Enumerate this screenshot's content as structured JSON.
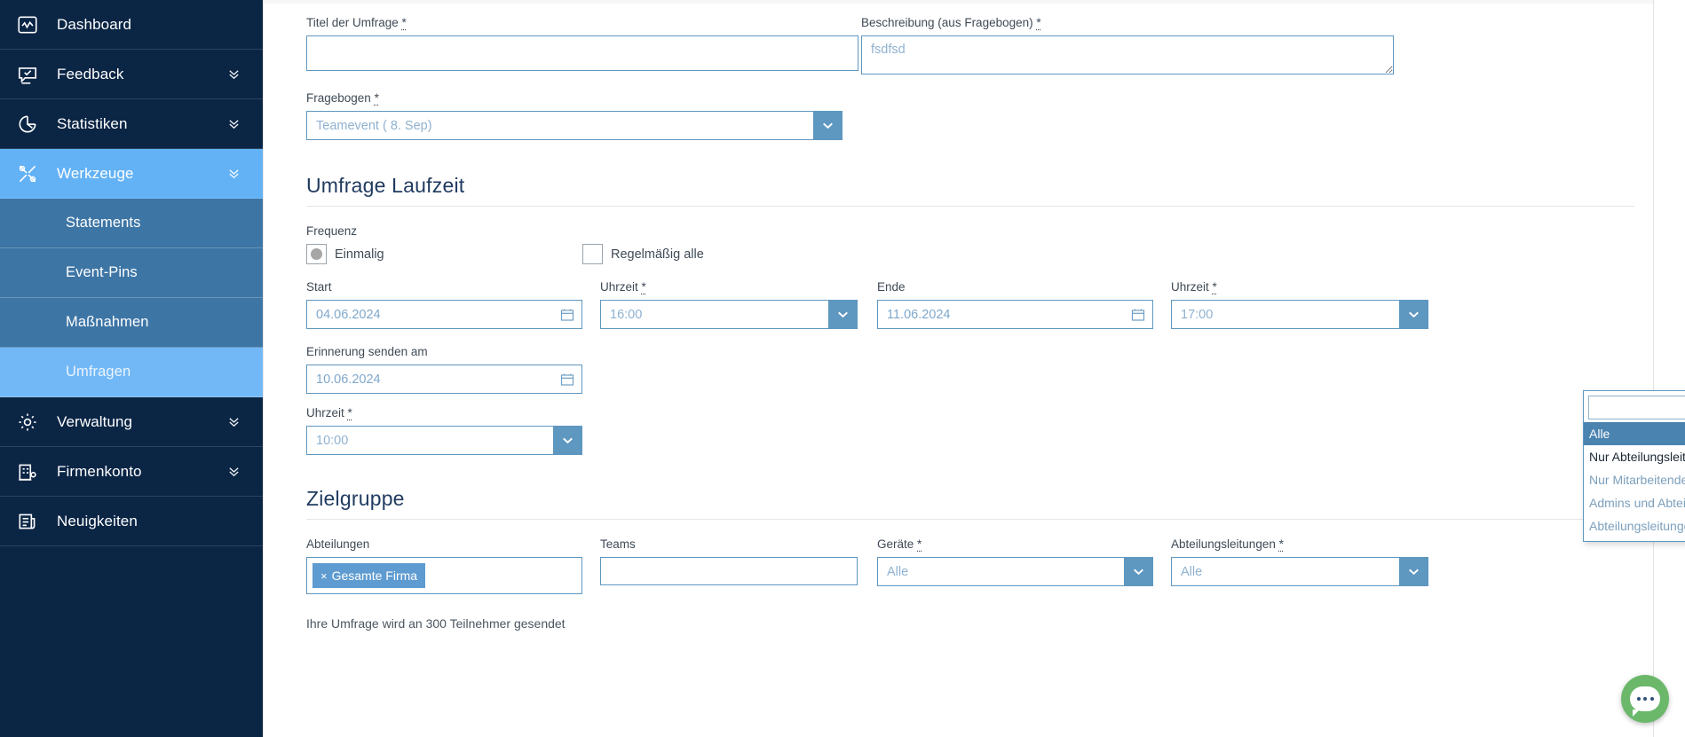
{
  "sidebar": {
    "items": [
      {
        "label": "Dashboard",
        "icon": "activity-icon",
        "caret": false,
        "state": "normal",
        "sub": false
      },
      {
        "label": "Feedback",
        "icon": "feedback-icon",
        "caret": true,
        "state": "normal",
        "sub": false
      },
      {
        "label": "Statistiken",
        "icon": "pie-chart-icon",
        "caret": true,
        "state": "normal",
        "sub": false
      },
      {
        "label": "Werkzeuge",
        "icon": "tools-icon",
        "caret": true,
        "state": "active",
        "sub": false
      },
      {
        "label": "Statements",
        "icon": "",
        "caret": false,
        "state": "subitem",
        "sub": true
      },
      {
        "label": "Event-Pins",
        "icon": "",
        "caret": false,
        "state": "subitem",
        "sub": true
      },
      {
        "label": "Maßnahmen",
        "icon": "",
        "caret": false,
        "state": "subitem",
        "sub": true
      },
      {
        "label": "Umfragen",
        "icon": "",
        "caret": false,
        "state": "subitem-active",
        "sub": true
      },
      {
        "label": "Verwaltung",
        "icon": "gear-icon",
        "caret": true,
        "state": "normal",
        "sub": false
      },
      {
        "label": "Firmenkonto",
        "icon": "building-icon",
        "caret": true,
        "state": "normal",
        "sub": false
      },
      {
        "label": "Neuigkeiten",
        "icon": "news-icon",
        "caret": false,
        "state": "normal",
        "sub": false
      }
    ]
  },
  "form": {
    "title_field": {
      "label": "Titel der Umfrage",
      "required": true,
      "value": "",
      "placeholder": ""
    },
    "description_field": {
      "label": "Beschreibung (aus Fragebogen)",
      "required": true,
      "value": "",
      "placeholder": "fsdfsd"
    },
    "questionnaire_field": {
      "label": "Fragebogen",
      "required": true,
      "value": "Teamevent ( 8. Sep)"
    }
  },
  "runtime_section": {
    "heading": "Umfrage Laufzeit",
    "frequency": {
      "label": "Frequenz",
      "once_label": "Einmalig",
      "once_selected": true,
      "recurring_label": "Regelmäßig alle",
      "recurring_selected": false
    },
    "start": {
      "label": "Start",
      "required": false,
      "value": "04.06.2024"
    },
    "start_time": {
      "label": "Uhrzeit",
      "required": true,
      "value": "16:00"
    },
    "end": {
      "label": "Ende",
      "required": false,
      "value": "11.06.2024"
    },
    "end_time": {
      "label": "Uhrzeit",
      "required": true,
      "value": "17:00"
    },
    "reminder": {
      "label": "Erinnerung senden am",
      "required": false,
      "value": "10.06.2024"
    },
    "reminder_time": {
      "label": "Uhrzeit",
      "required": true,
      "value": "10:00"
    }
  },
  "target_section": {
    "heading": "Zielgruppe",
    "departments": {
      "label": "Abteilungen",
      "required": false,
      "tags": [
        "Gesamte Firma"
      ],
      "tag_remove": "×"
    },
    "teams": {
      "label": "Teams",
      "required": false,
      "value": ""
    },
    "devices": {
      "label": "Geräte",
      "required": true,
      "value": "Alle"
    },
    "roles": {
      "label": "Abteilungsleitungen",
      "required": true,
      "value": "Alle"
    },
    "note": "Ihre Umfrage wird an 300 Teilnehmer gesendet"
  },
  "open_dropdown": {
    "search_value": "",
    "options": [
      {
        "label": "Alle",
        "selected": true,
        "hover": false
      },
      {
        "label": "Nur Abteilungsleitungen",
        "selected": false,
        "hover": true
      },
      {
        "label": "Nur Mitarbeitende",
        "selected": false,
        "hover": false
      },
      {
        "label": "Admins und Abteilungsleitungen",
        "selected": false,
        "hover": false
      },
      {
        "label": "Abteilungsleitungen & Mitarbeitende",
        "selected": false,
        "hover": false
      }
    ]
  },
  "chat_widget": {
    "icon": "chat-bubble-icon"
  },
  "colors": {
    "sidebar_bg": "#0b2545",
    "sidebar_active": "#63b2f5",
    "sidebar_sub": "#3d75a5",
    "field_border": "#5e97c0",
    "accent": "#4a82b0",
    "chat_green": "#6bb86b"
  }
}
